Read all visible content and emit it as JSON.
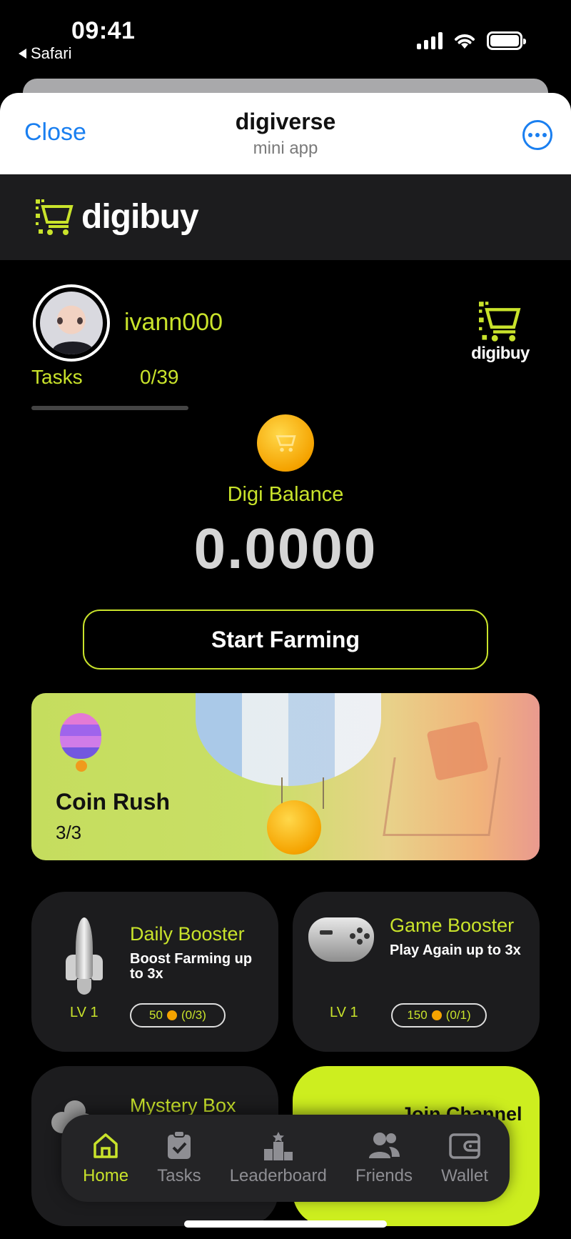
{
  "status_bar": {
    "time": "09:41",
    "back_app": "Safari"
  },
  "mini_app_header": {
    "close_label": "Close",
    "title": "digiverse",
    "subtitle": "mini app"
  },
  "brand": {
    "name": "digibuy",
    "corner_logo_text": "digibuy",
    "accent_color": "#c9e32b"
  },
  "profile": {
    "username": "ivann000",
    "tasks_label": "Tasks",
    "tasks_count": "0/39",
    "tasks_progress": 0
  },
  "balance": {
    "label": "Digi Balance",
    "value": "0.0000"
  },
  "actions": {
    "start_farming": "Start Farming"
  },
  "coin_rush": {
    "title": "Coin Rush",
    "count": "3/3"
  },
  "boosters": [
    {
      "title": "Daily Booster",
      "description": "Boost Farming up to 3x",
      "level": "LV 1",
      "cost": "50",
      "uses": "(0/3)"
    },
    {
      "title": "Game Booster",
      "description": "Play Again up to 3x",
      "level": "LV 1",
      "cost": "150",
      "uses": "(0/1)"
    }
  ],
  "cards_partial": {
    "mystery_title": "Mystery Box",
    "join_title": "Join Channel"
  },
  "tabs": [
    {
      "label": "Home",
      "icon": "home-icon",
      "active": true
    },
    {
      "label": "Tasks",
      "icon": "clipboard-icon",
      "active": false
    },
    {
      "label": "Leaderboard",
      "icon": "podium-icon",
      "active": false
    },
    {
      "label": "Friends",
      "icon": "people-icon",
      "active": false
    },
    {
      "label": "Wallet",
      "icon": "wallet-icon",
      "active": false
    }
  ]
}
